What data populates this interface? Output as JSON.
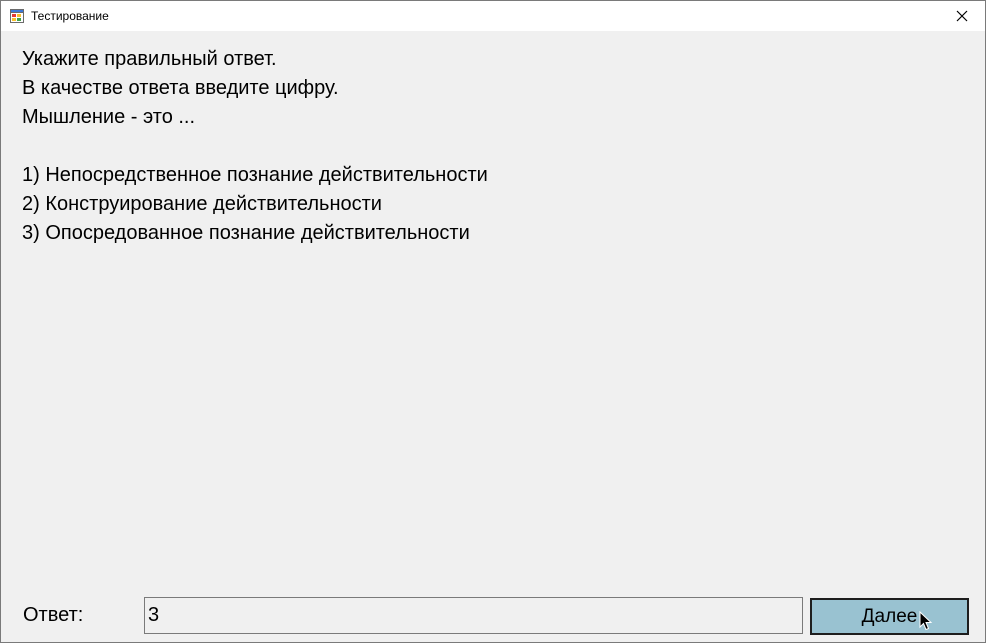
{
  "window": {
    "title": "Тестирование",
    "app_icon": "winforms-app-icon",
    "close_icon": "close-icon"
  },
  "question": {
    "lines": [
      "Укажите правильный ответ.",
      "В качестве ответа введите цифру.",
      "Мышление - это ...",
      "",
      "1) Непосредственное познание действительности",
      "2) Конструирование действительности",
      "3) Опосредованное познание действительности"
    ]
  },
  "answer": {
    "label": "Ответ:",
    "value": "3"
  },
  "next_button": {
    "label": "Далее"
  },
  "colors": {
    "button_bg": "#99c2d1",
    "client_bg": "#f0f0f0"
  }
}
